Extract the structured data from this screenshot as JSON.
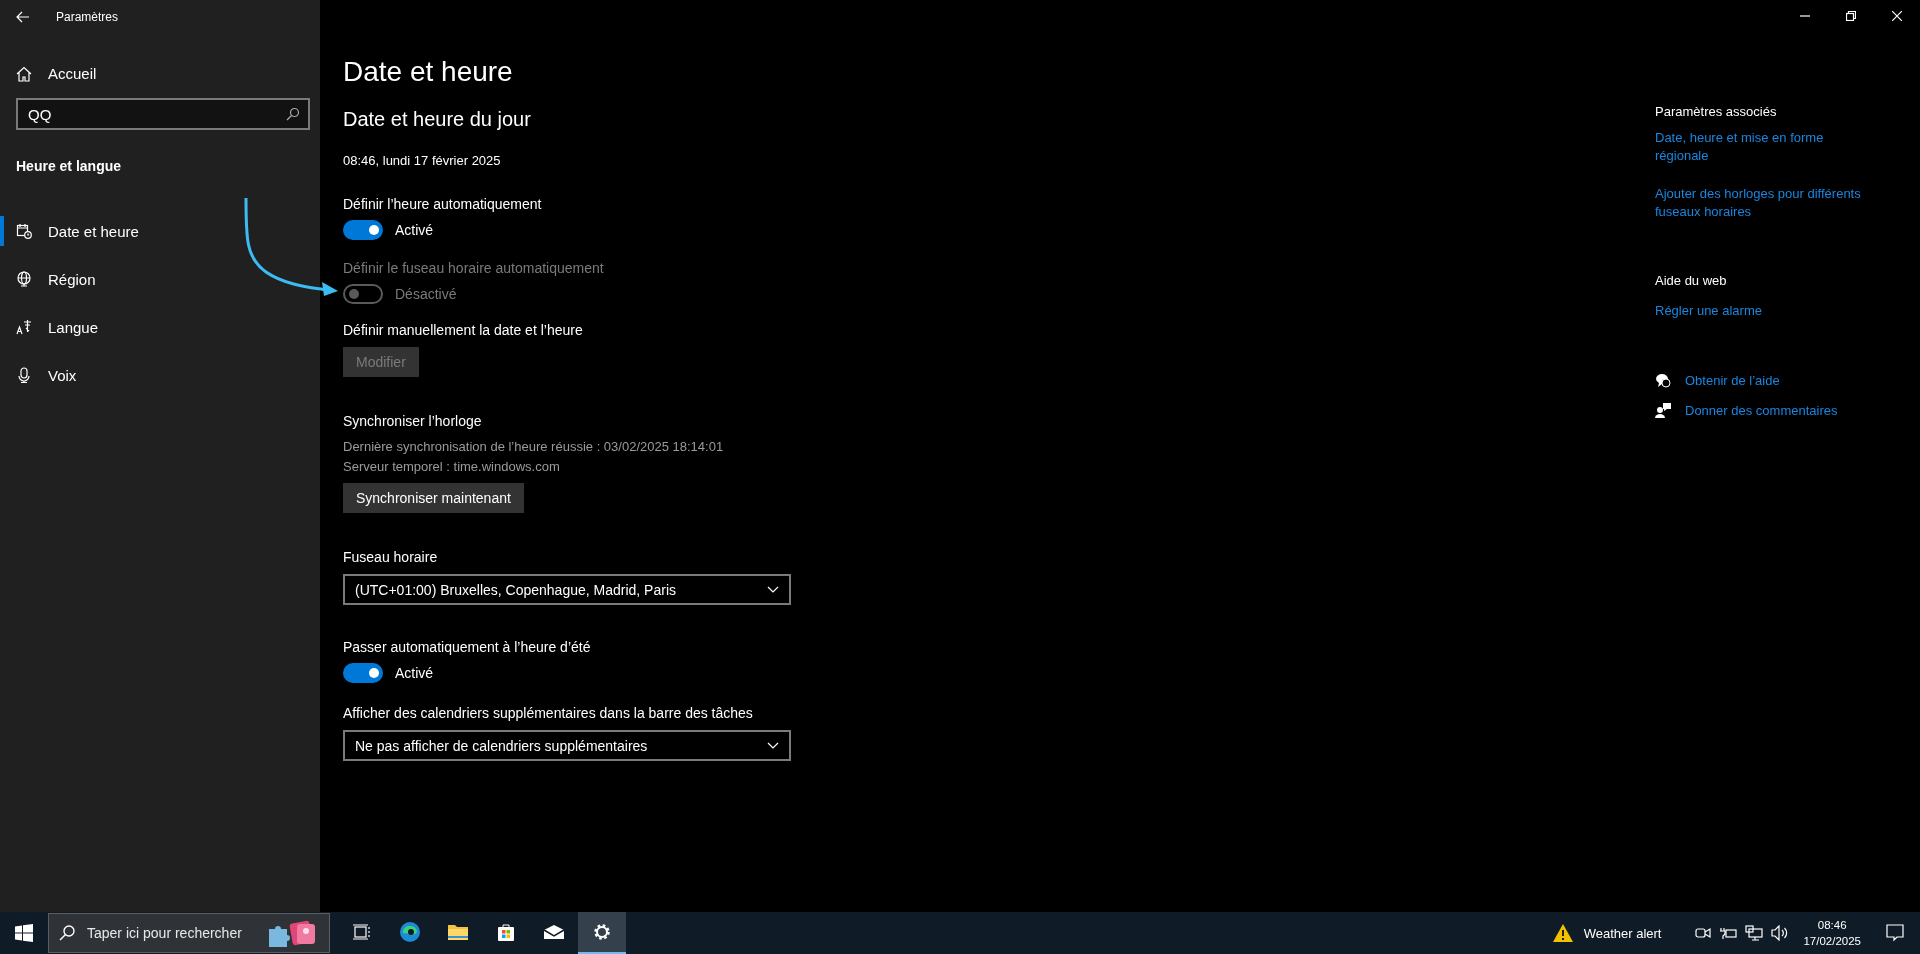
{
  "window": {
    "title": "Paramètres"
  },
  "sidebar": {
    "home": "Accueil",
    "search": {
      "value": "QQ"
    },
    "section": "Heure et langue",
    "items": [
      {
        "label": "Date et heure",
        "selected": true
      },
      {
        "label": "Région",
        "selected": false
      },
      {
        "label": "Langue",
        "selected": false
      },
      {
        "label": "Voix",
        "selected": false
      }
    ]
  },
  "main": {
    "title": "Date et heure",
    "subtitle": "Date et heure du jour",
    "current_time": "08:46, lundi 17 février 2025",
    "settings": [
      {
        "kind": "toggle",
        "label": "Définir l’heure automatiquement",
        "on": true,
        "disabled": false,
        "state_text": "Activé"
      },
      {
        "kind": "toggle",
        "label": "Définir le fuseau horaire automatiquement",
        "on": false,
        "disabled": true,
        "state_text": "Désactivé"
      },
      {
        "kind": "button",
        "label": "Définir manuellement la date et l’heure",
        "button": "Modifier",
        "disabled": true
      },
      {
        "kind": "info",
        "label": "Synchroniser l’horloge",
        "lines": [
          "Dernière synchronisation de l’heure réussie : 03/02/2025 18:14:01",
          "Serveur temporel : time.windows.com"
        ],
        "button": "Synchroniser maintenant",
        "disabled": false
      },
      {
        "kind": "select",
        "label": "Fuseau horaire",
        "value": "(UTC+01:00) Bruxelles, Copenhague, Madrid, Paris"
      },
      {
        "kind": "toggle",
        "label": "Passer automatiquement à l’heure d’été",
        "on": true,
        "disabled": false,
        "state_text": "Activé"
      },
      {
        "kind": "select",
        "label": "Afficher des calendriers supplémentaires dans la barre des tâches",
        "value": "Ne pas afficher de calendriers supplémentaires"
      }
    ]
  },
  "related": {
    "heading": "Paramètres associés",
    "links": [
      "Date, heure et mise en forme régionale",
      "Ajouter des horloges pour différents fuseaux horaires"
    ],
    "web_heading": "Aide du web",
    "web_links": [
      "Régler une alarme"
    ],
    "help_links": [
      "Obtenir de l’aide",
      "Donner des commentaires"
    ]
  },
  "taskbar": {
    "search_placeholder": "Taper ici pour rechercher",
    "apps": [
      {
        "active": false
      },
      {
        "active": false
      },
      {
        "active": false
      },
      {
        "active": false
      },
      {
        "active": false
      },
      {
        "active": true
      }
    ],
    "weather": "Weather alert",
    "time": "08:46",
    "date": "17/02/2025"
  }
}
